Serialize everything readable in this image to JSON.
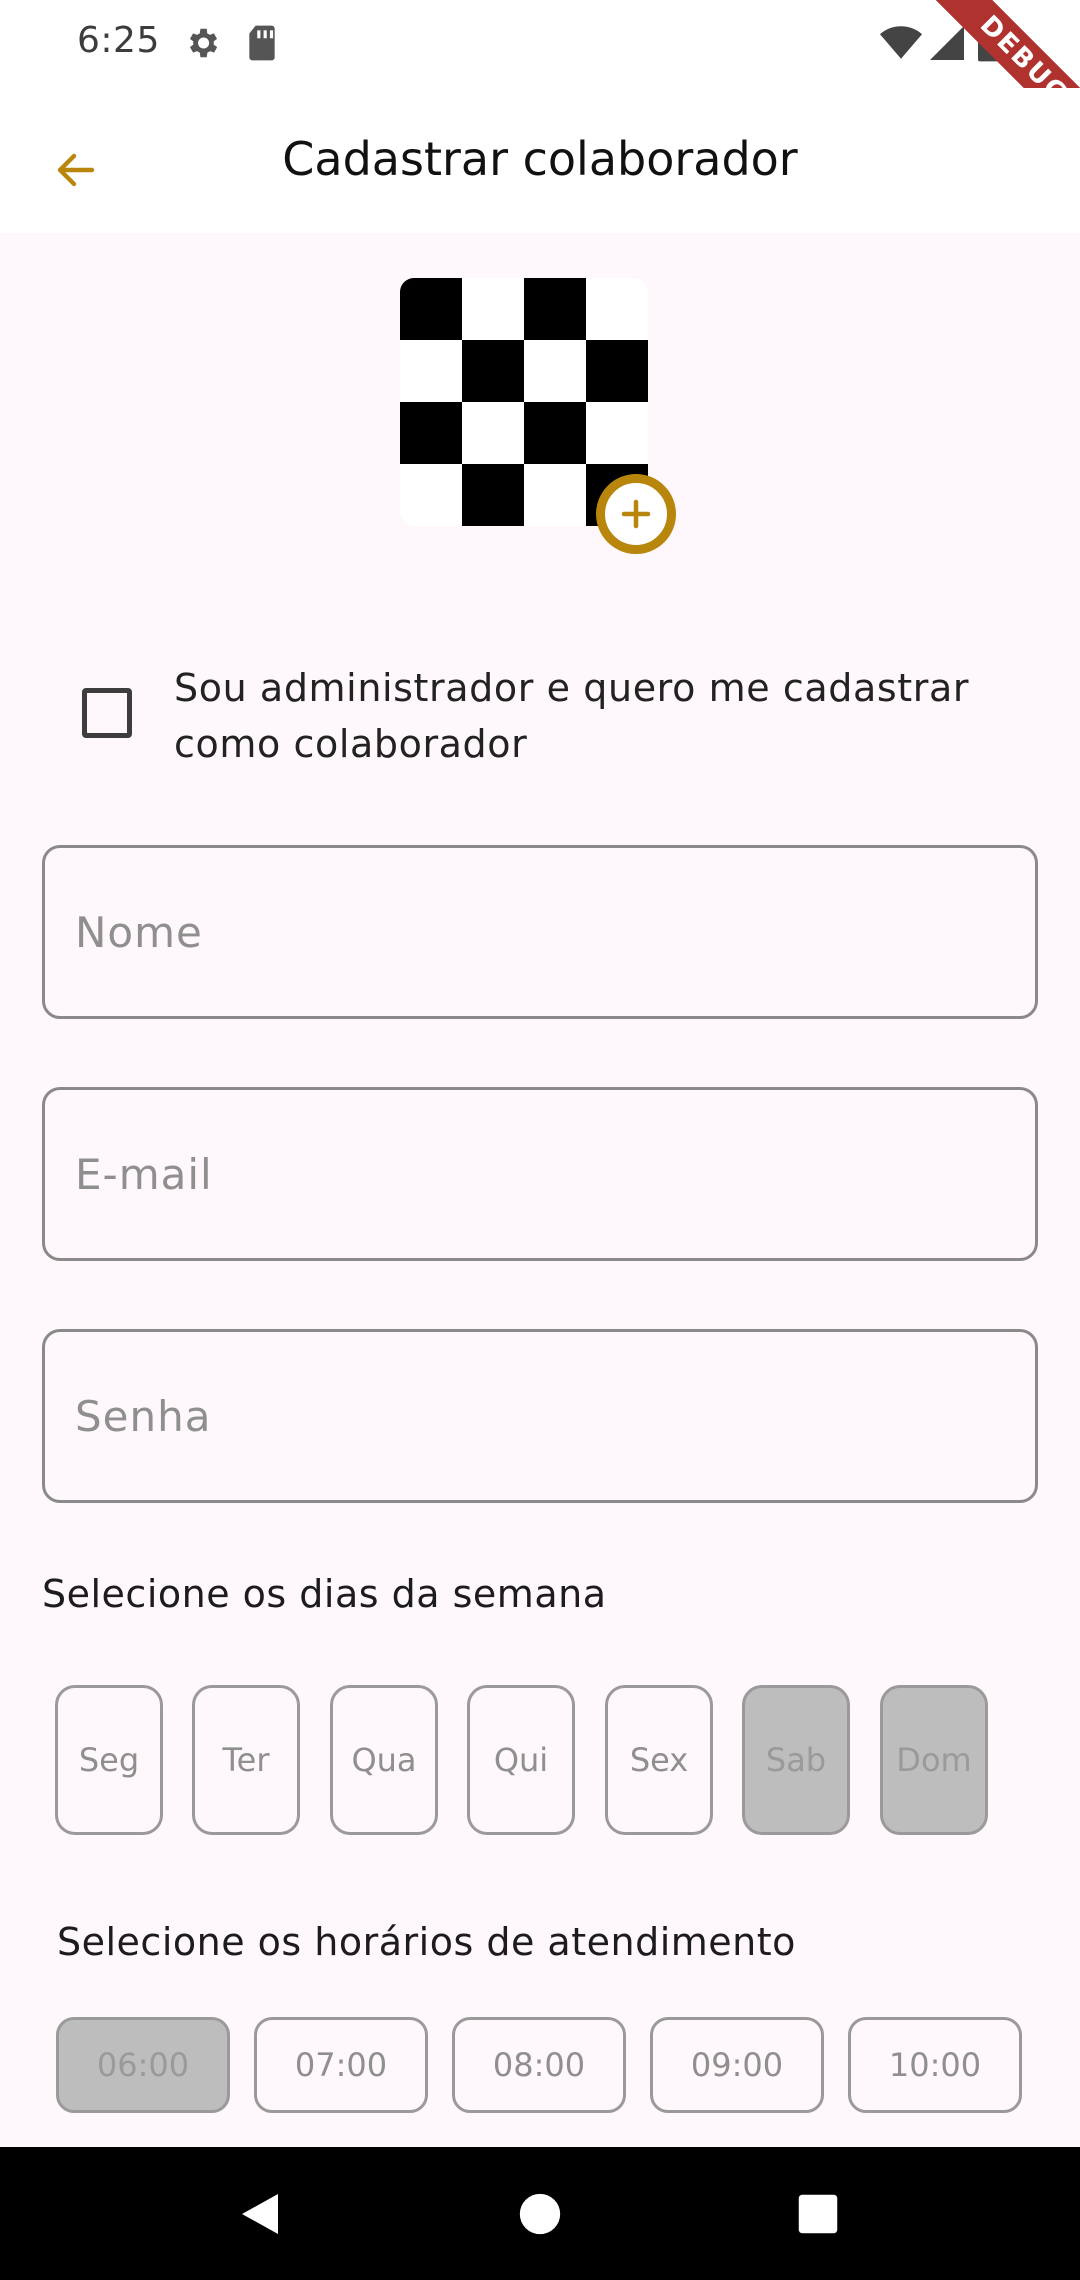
{
  "status_bar": {
    "time": "6:25",
    "icons": [
      "gear-icon",
      "sd-card-icon",
      "wifi-icon",
      "signal-icon",
      "battery-icon"
    ],
    "debug_label": "DEBUG"
  },
  "app_bar": {
    "title": "Cadastrar colaborador",
    "back_icon": "arrow-back-icon",
    "accent_color": "#B8860B"
  },
  "avatar": {
    "add_icon": "add-circle-icon"
  },
  "admin_checkbox": {
    "label": "Sou administrador e quero me cadastrar como colaborador",
    "checked": false
  },
  "form": {
    "nome_placeholder": "Nome",
    "email_placeholder": "E-mail",
    "senha_placeholder": "Senha"
  },
  "days": {
    "label": "Selecione os dias da semana",
    "items": [
      {
        "label": "Seg",
        "selected": false
      },
      {
        "label": "Ter",
        "selected": false
      },
      {
        "label": "Qua",
        "selected": false
      },
      {
        "label": "Qui",
        "selected": false
      },
      {
        "label": "Sex",
        "selected": false
      },
      {
        "label": "Sab",
        "selected": true
      },
      {
        "label": "Dom",
        "selected": true
      }
    ]
  },
  "hours": {
    "label": "Selecione os horários de atendimento",
    "items": [
      {
        "label": "06:00",
        "selected": true
      },
      {
        "label": "07:00",
        "selected": false
      },
      {
        "label": "08:00",
        "selected": false
      },
      {
        "label": "09:00",
        "selected": false
      },
      {
        "label": "10:00",
        "selected": false
      }
    ]
  },
  "nav_bar": {
    "icons": [
      "back-triangle-icon",
      "home-circle-icon",
      "recents-square-icon"
    ]
  }
}
